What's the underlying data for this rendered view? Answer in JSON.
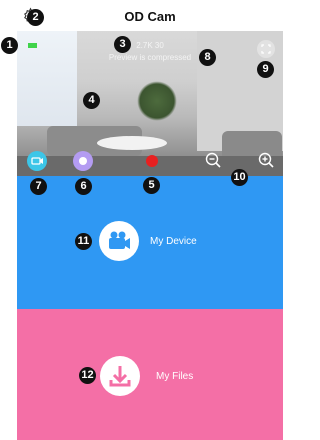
{
  "header": {
    "title": "OD Cam",
    "settings_icon": "gear-icon"
  },
  "preview": {
    "resolution": "2.7K 30",
    "notice": "Preview is compressed",
    "recording_indicator_color": "#3fd34a",
    "controls": {
      "camera_mode_icon": "video-camera-icon",
      "snapshot_icon": "camera-shutter-icon",
      "record_icon": "record-dot-icon",
      "zoom_out_icon": "zoom-out-icon",
      "zoom_in_icon": "zoom-in-icon",
      "fullscreen_icon": "fullscreen-icon"
    }
  },
  "panels": {
    "device": {
      "label": "My Device",
      "color": "#2f98f3",
      "icon": "video-camera-icon"
    },
    "files": {
      "label": "My Files",
      "color": "#f46fa6",
      "icon": "download-icon"
    }
  },
  "callouts": [
    "1",
    "2",
    "3",
    "4",
    "5",
    "6",
    "7",
    "8",
    "9",
    "10",
    "11",
    "12"
  ]
}
